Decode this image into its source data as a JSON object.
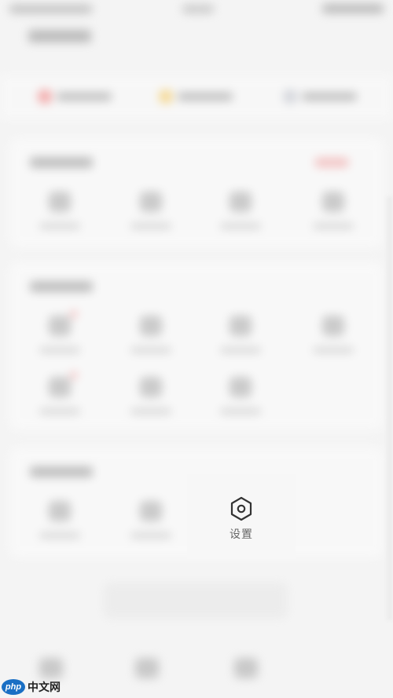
{
  "overlay": {
    "settings_label": "设置",
    "icon": "hexagon-settings-icon"
  },
  "watermark": {
    "logo_text": "php",
    "site_text": "中文网"
  },
  "colors": {
    "background": "#f4f4f4",
    "icon_stroke": "#333333",
    "label": "#666666",
    "badge_red": "#f06a6a",
    "stat_red": "#f26b6b",
    "stat_yellow": "#f6c244",
    "stat_gray": "#b7bbc6"
  }
}
